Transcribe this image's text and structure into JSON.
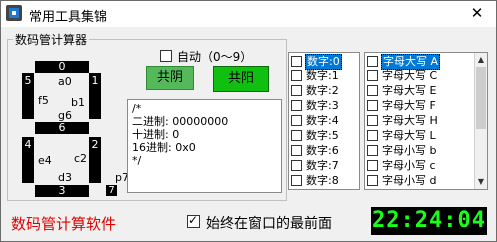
{
  "window": {
    "title": "常用工具集锦",
    "close_glyph": "✕"
  },
  "group": {
    "label": "数码管计算器"
  },
  "segments": {
    "top": "0",
    "a_label": "a0",
    "upper_left": "5",
    "upper_right": "1",
    "f_label": "f5",
    "b_label": "b1",
    "middle": "6",
    "g_label": "g6",
    "lower_left": "4",
    "lower_right": "2",
    "e_label": "e4",
    "c_label": "c2",
    "d_label": "d3",
    "bottom": "3",
    "dp": "7",
    "p_label": "p7"
  },
  "controls": {
    "auto_label": "自动（0～9）",
    "auto_checked": false,
    "common_cathode": "共阴",
    "common_anode": "共阳"
  },
  "info": {
    "lines": [
      "/*",
      "二进制: 00000000",
      "十进制: 0",
      "16进制: 0x0",
      "*/"
    ]
  },
  "digits_list": {
    "items": [
      {
        "label": "数字:0",
        "selected": true
      },
      {
        "label": "数字:1"
      },
      {
        "label": "数字:2"
      },
      {
        "label": "数字:3"
      },
      {
        "label": "数字:4"
      },
      {
        "label": "数字:5"
      },
      {
        "label": "数字:6"
      },
      {
        "label": "数字:7"
      },
      {
        "label": "数字:8"
      }
    ]
  },
  "letters_list": {
    "items": [
      {
        "label": "字母大写 A",
        "selected": true
      },
      {
        "label": "字母大写 C"
      },
      {
        "label": "字母大写 E"
      },
      {
        "label": "字母大写 F"
      },
      {
        "label": "字母大写 H"
      },
      {
        "label": "字母大写 L"
      },
      {
        "label": "字母小写 b"
      },
      {
        "label": "字母小写 c"
      },
      {
        "label": "字母小写 d"
      }
    ]
  },
  "footer": {
    "app_name": "数码管计算软件",
    "always_on_top_label": "始终在窗口的最前面",
    "always_on_top_checked": true,
    "clock": "22:24:04"
  },
  "colors": {
    "common_cathode_bg": "#55b85a",
    "common_anode_bg": "#10c010",
    "app_name": "#e00000",
    "clock_fg": "#19ff19",
    "selection": "#0078d7"
  }
}
